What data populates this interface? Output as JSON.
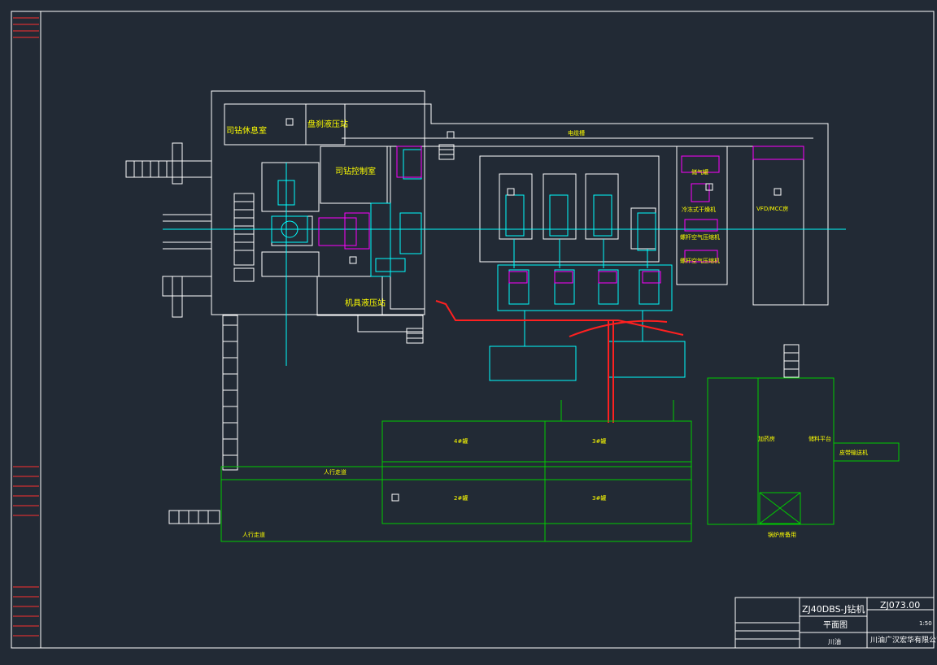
{
  "labels": {
    "driller_lounge": "司钻休息室",
    "disc_brake_hpu": "盘刹液压站",
    "driller_control_room": "司钻控制室",
    "tool_hpu": "机具液压站",
    "cable_trench": "电缆槽",
    "exhaust": "储气罐",
    "cold_dryer": "冷冻式干燥机",
    "screw_compressor_1": "螺杆空气压缩机",
    "screw_compressor_2": "螺杆空气压缩机",
    "vfd_mcc": "VFD/MCC房",
    "tank_4": "4#罐",
    "tank_3": "3#罐",
    "tank_2": "2#罐",
    "tank_3b": "3#罐",
    "walkway_1": "人行走道",
    "walkway_2": "人行走道",
    "dosing_room": "加药房",
    "mixing_platform": "储料平台",
    "transfer_belt": "皮带输送机",
    "water_room": "锅炉房备用"
  },
  "title_block": {
    "project": "ZJ40DBS-J钻机",
    "drawing_no": "ZJ073.00",
    "drawing_name": "平面图",
    "company": "川油广汉宏华有限公司",
    "scale": "1:50",
    "region": "川油"
  },
  "colors": {
    "background": "#222a35",
    "frame": "#ffffff",
    "equipment": "#00ffff",
    "tanks": "#00cc00",
    "text": "#ffff00",
    "hydraulic": "#ff00ff",
    "piping": "#ff2020"
  }
}
